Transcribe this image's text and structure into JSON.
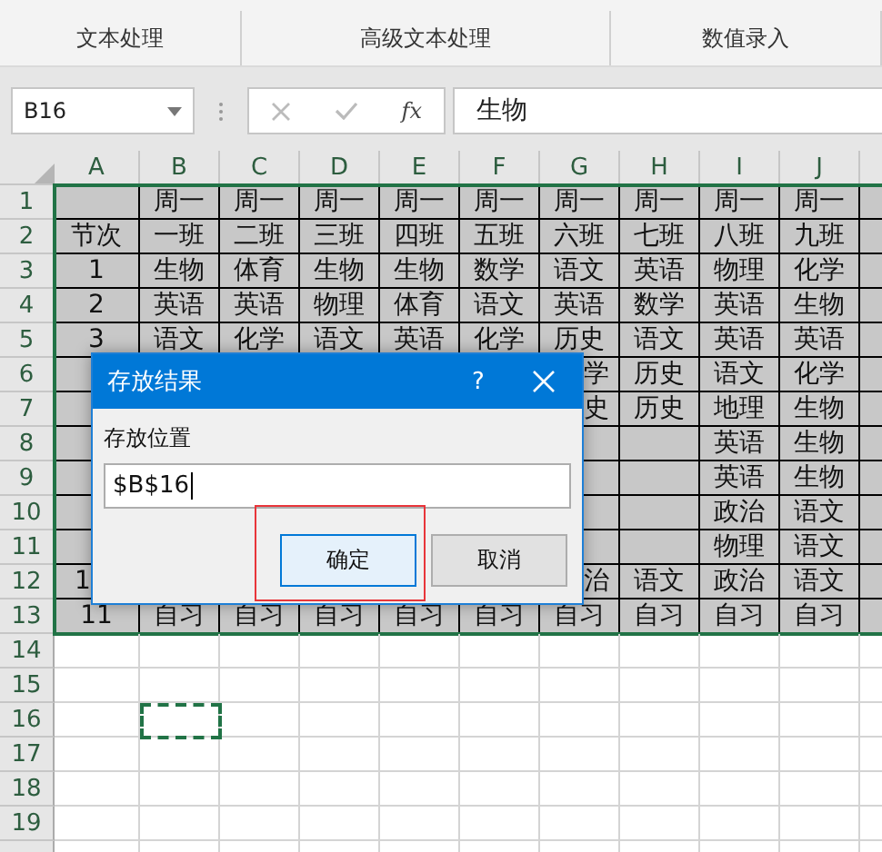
{
  "ribbon": {
    "groups": [
      "文本处理",
      "高级文本处理",
      "数值录入"
    ]
  },
  "formula_bar": {
    "name_box": "B16",
    "fx_label": "fx",
    "formula": "生物"
  },
  "sheet": {
    "columns": [
      "A",
      "B",
      "C",
      "D",
      "E",
      "F",
      "G",
      "H",
      "I",
      "J"
    ],
    "row_numbers": [
      "1",
      "2",
      "3",
      "4",
      "5",
      "6",
      "7",
      "8",
      "9",
      "10",
      "11",
      "12",
      "13",
      "14",
      "15",
      "16",
      "17",
      "18",
      "19"
    ],
    "rows": [
      [
        null,
        "周一",
        "周一",
        "周一",
        "周一",
        "周一",
        "周一",
        "周一",
        "周一",
        "周一"
      ],
      [
        "节次",
        "一班",
        "二班",
        "三班",
        "四班",
        "五班",
        "六班",
        "七班",
        "八班",
        "九班"
      ],
      [
        "1",
        "生物",
        "体育",
        "生物",
        "生物",
        "数学",
        "语文",
        "英语",
        "物理",
        "化学"
      ],
      [
        "2",
        "英语",
        "英语",
        "物理",
        "体育",
        "语文",
        "英语",
        "数学",
        "英语",
        "生物"
      ],
      [
        "3",
        "语文",
        "化学",
        "语文",
        "英语",
        "化学",
        "历史",
        "语文",
        "英语",
        "英语"
      ],
      [
        null,
        null,
        null,
        null,
        null,
        null,
        {
          "text": "学",
          "align_right": true
        },
        "历史",
        "语文",
        "化学"
      ],
      [
        null,
        null,
        null,
        null,
        null,
        null,
        {
          "text": "史",
          "align_right": true
        },
        "历史",
        "地理",
        "生物"
      ],
      [
        null,
        null,
        null,
        null,
        null,
        null,
        null,
        null,
        "英语",
        "生物"
      ],
      [
        null,
        null,
        null,
        null,
        null,
        null,
        null,
        null,
        "英语",
        "生物"
      ],
      [
        null,
        null,
        null,
        null,
        null,
        null,
        null,
        null,
        "政治",
        "语文"
      ],
      [
        null,
        null,
        null,
        null,
        null,
        null,
        null,
        null,
        "物理",
        "语文"
      ],
      [
        {
          "text": "1",
          "align_right": false
        },
        null,
        null,
        null,
        null,
        null,
        {
          "text": "治",
          "align_right": true
        },
        "语文",
        "政治",
        "语文"
      ],
      [
        "11",
        "自习",
        "自习",
        "自习",
        "自习",
        "自习",
        "自习",
        "自习",
        "自习",
        "自习"
      ]
    ]
  },
  "dialog": {
    "title": "存放结果",
    "help": "?",
    "field_label": "存放位置",
    "value": "$B$16",
    "buttons": [
      {
        "label": "确定",
        "focused": true
      },
      {
        "label": "取消",
        "focused": false
      }
    ]
  }
}
